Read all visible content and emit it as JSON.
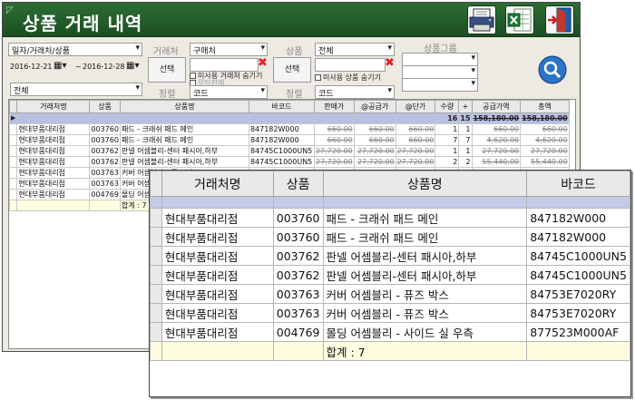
{
  "window": {
    "title": "상품 거래 내역"
  },
  "toolbar": {
    "icons": {
      "printer": "printer-icon",
      "excel": "excel-icon",
      "exit": "exit-door-icon",
      "search": "search-icon"
    }
  },
  "filters": {
    "group_selector": "일자/거래처/상품",
    "date_from": "2016-12-21",
    "date_sep": "~",
    "date_to": "2016-12-28",
    "left_bottom_combo": "전체",
    "client_label": "거래처",
    "client_type": "구매처",
    "client_select_btn": "선택",
    "client_hide_unused": "미사용 거래처 숨기기",
    "client_option2": "위탁판매",
    "sort_label": "정렬",
    "sort_value": "코드",
    "product_label": "상품",
    "product_value": "전체",
    "product_select_btn": "선택",
    "product_hide_unused": "미사용 상품 숨기기",
    "sort2_label": "정렬",
    "sort2_value": "코드",
    "group_label": "상품그룹"
  },
  "grid": {
    "columns": [
      "거래처명",
      "상품",
      "상품명",
      "바코드",
      "판매가",
      "@공급가",
      "@단가",
      "수량",
      "+",
      "공급가액",
      "총액"
    ],
    "totals": [
      "",
      "",
      "",
      "",
      "",
      "",
      "",
      "16",
      "15",
      "158,180.00",
      "158,180.00"
    ],
    "rows": [
      [
        "현대부품대리점",
        "003760",
        "패드 - 크래쉬 패드 메인",
        "847182W000",
        "660.00",
        "660.00",
        "660.00",
        "1",
        "1",
        "660.00",
        "660.00"
      ],
      [
        "현대부품대리점",
        "003760",
        "패드 - 크래쉬 패드 메인",
        "847182W000",
        "660.00",
        "660.00",
        "660.00",
        "7",
        "7",
        "4,620.00",
        "4,620.00"
      ],
      [
        "현대부품대리점",
        "003762",
        "판넬 어셈블리-센터 패시아,하부",
        "84745C1000UN5",
        "27,720.00",
        "27,720.00",
        "27,720.00",
        "1",
        "1",
        "27,720.00",
        "27,720.00"
      ],
      [
        "현대부품대리점",
        "003762",
        "판넬 어셈블리-센터 패시아,하부",
        "84745C1000UN5",
        "27,720.00",
        "27,720.00",
        "27,720.00",
        "2",
        "2",
        "55,440.00",
        "55,440.00"
      ],
      [
        "현대부품대리점",
        "003763",
        "커버 어셈블리 - 퓨즈 박스",
        "84753E7020RY",
        "",
        "",
        "",
        "",
        "",
        "",
        ""
      ],
      [
        "현대부품대리점",
        "003763",
        "커버 어셈블리 - 퓨즈 박스",
        "84753E7020RY",
        "",
        "",
        "",
        "",
        "",
        "",
        ""
      ],
      [
        "현대부품대리점",
        "004769",
        "몰딩 어셈블리 - 사이드 실 우측",
        "877523M000AF",
        "",
        "",
        "",
        "",
        "",
        "",
        ""
      ]
    ],
    "sum_label": "합계 : 7"
  },
  "zoom": {
    "columns": [
      "거래처명",
      "상품",
      "상품명",
      "바코드"
    ]
  }
}
